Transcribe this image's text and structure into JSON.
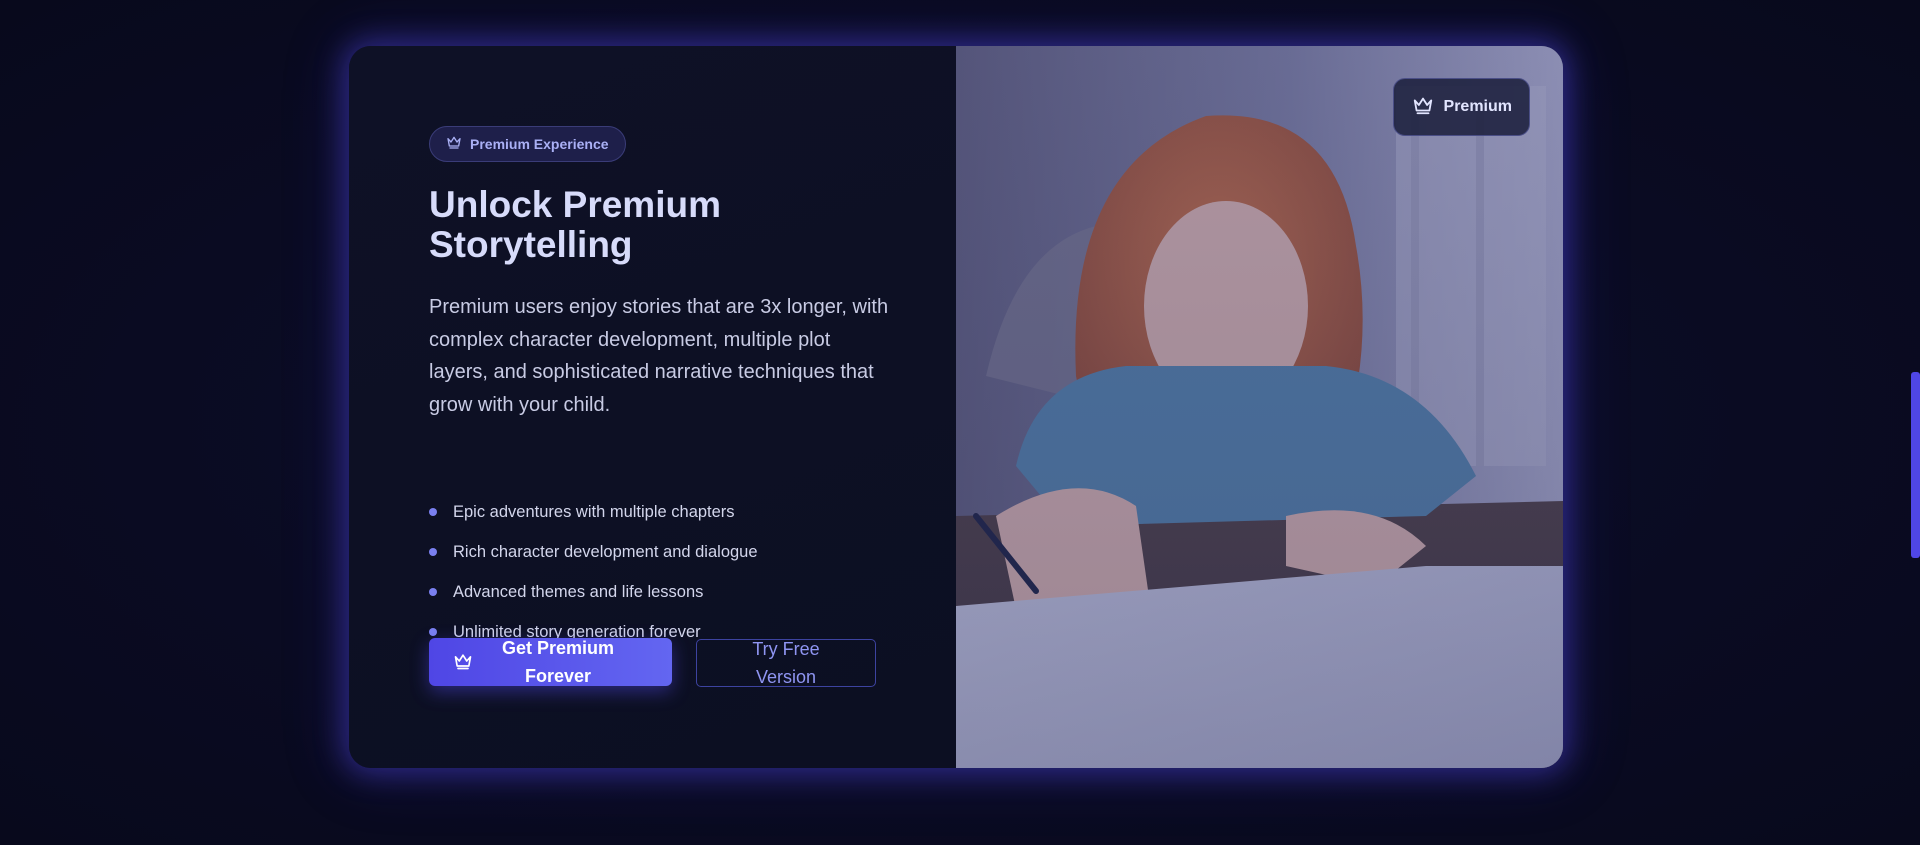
{
  "hero": {
    "badge_label": "Premium Experience",
    "title": "Unlock Premium Storytelling",
    "description": "Premium users enjoy stories that are 3x longer, with complex character development, multiple plot layers, and sophisticated narrative techniques that grow with your child.",
    "features": [
      "Epic adventures with multiple chapters",
      "Rich character development and dialogue",
      "Advanced themes and life lessons",
      "Unlimited story generation forever"
    ],
    "primary_button_label": "Get Premium Forever",
    "secondary_button_label": "Try Free Version",
    "icons": {
      "badge": "crown-icon",
      "primary_button": "crown-icon",
      "image_pill": "crown-icon"
    }
  },
  "image_panel": {
    "pill_label": "Premium",
    "image_subject": "child-drawing-photo"
  },
  "colors": {
    "accent": "#4f46e5",
    "accent_light": "#6366f1",
    "background": "#0a0b22",
    "card": "#0d1023"
  }
}
